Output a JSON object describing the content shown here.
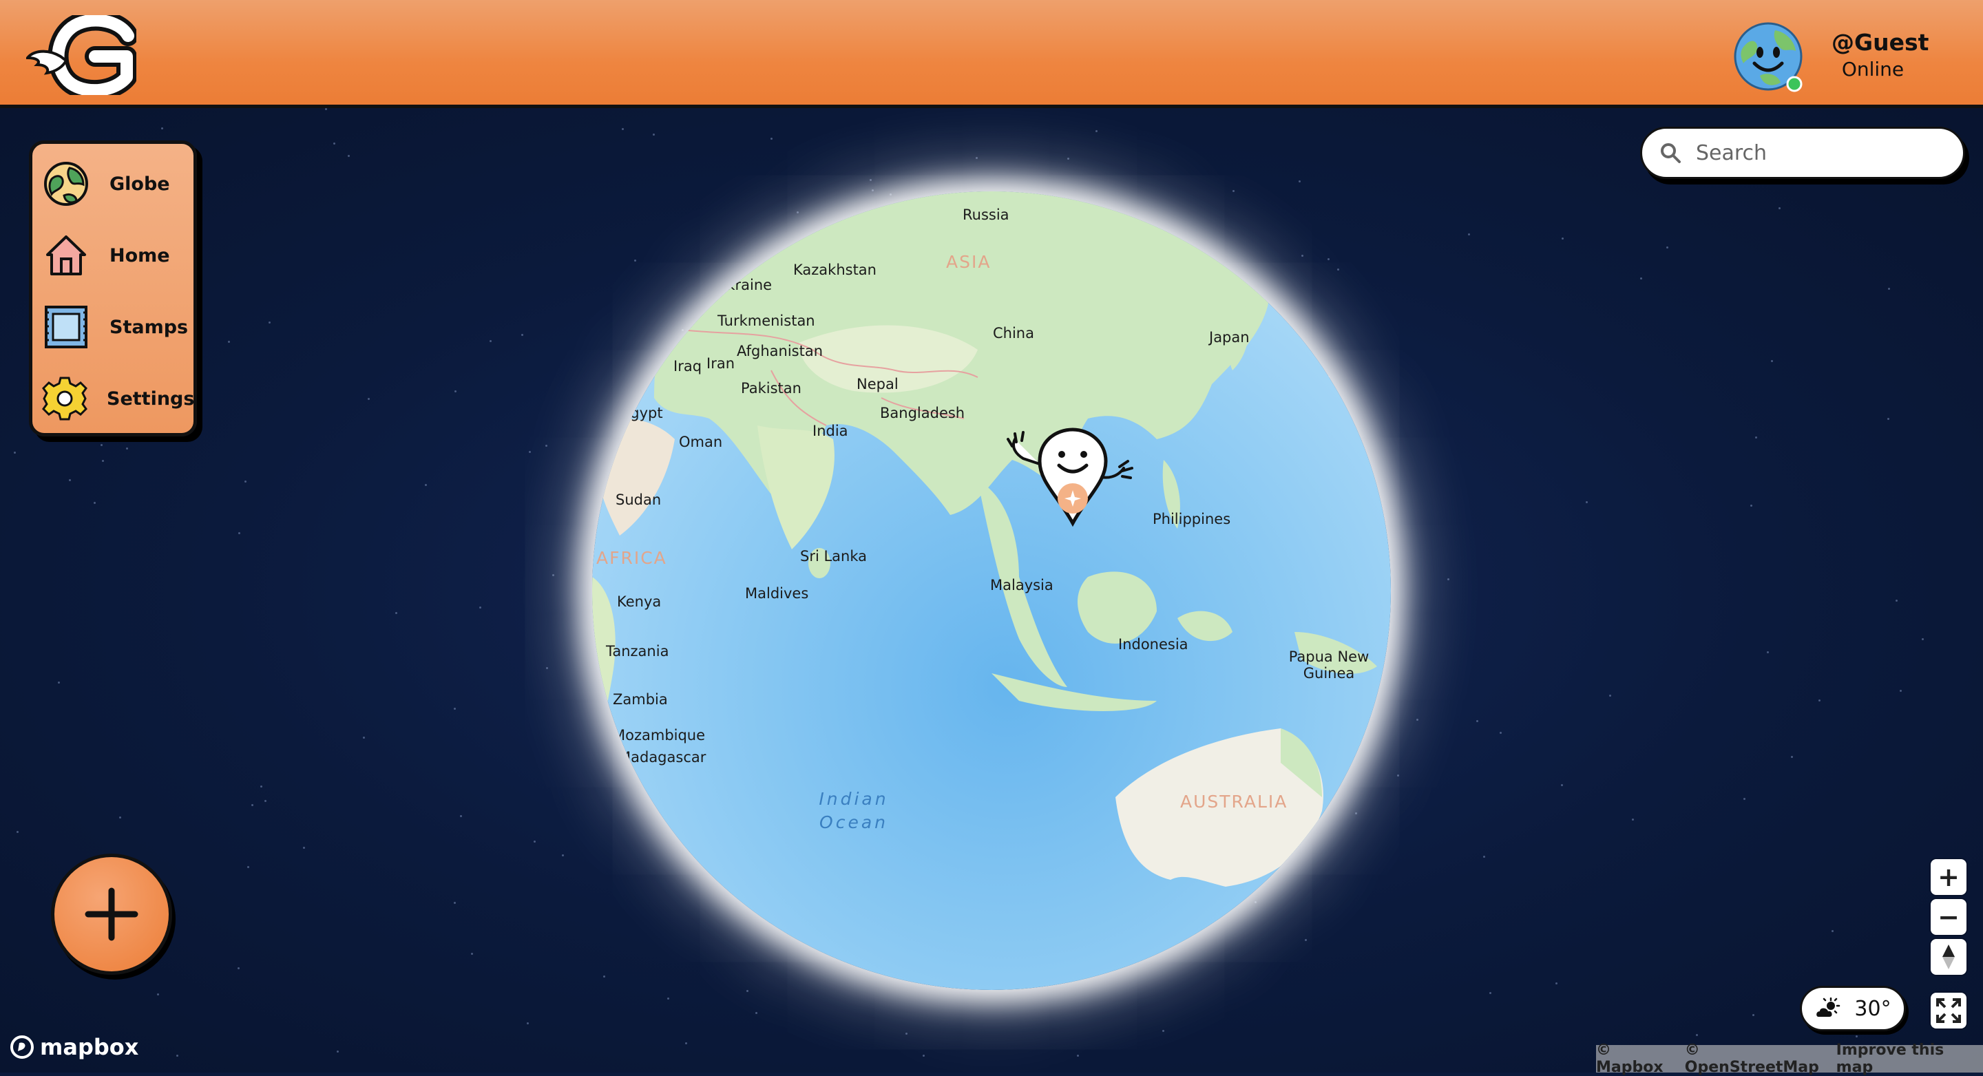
{
  "header": {
    "user": {
      "name": "@Guest",
      "status": "Online"
    }
  },
  "sidebar": {
    "items": [
      {
        "label": "Globe",
        "icon": "globe-icon"
      },
      {
        "label": "Home",
        "icon": "home-icon"
      },
      {
        "label": "Stamps",
        "icon": "stamp-icon"
      },
      {
        "label": "Settings",
        "icon": "gear-icon"
      }
    ]
  },
  "search": {
    "placeholder": "Search"
  },
  "map": {
    "countries": [
      "Russia",
      "Kazakhstan",
      "Ukraine",
      "Turkmenistan",
      "Afghanistan",
      "Iraq",
      "Iran",
      "Pakistan",
      "Nepal",
      "China",
      "Japan",
      "Bangladesh",
      "India",
      "Egypt",
      "Oman",
      "Sudan",
      "Kenya",
      "Tanzania",
      "Zambia",
      "Mozambique",
      "Madagascar",
      "Sri Lanka",
      "Maldives",
      "Malaysia",
      "Philippines",
      "Indonesia",
      "Papua New Guinea"
    ],
    "regions": [
      "ASIA",
      "AFRICA",
      "AUSTRALIA"
    ],
    "ocean": "Indian Ocean"
  },
  "weather": {
    "temperature": "30°",
    "icon": "partly-sunny-icon"
  },
  "controls": {
    "zoom_in": "+",
    "zoom_out": "−"
  },
  "footer": {
    "logo_text": "mapbox",
    "attribution": [
      "© Mapbox",
      "© OpenStreetMap",
      "Improve this map"
    ]
  },
  "colors": {
    "header": "#ee8540",
    "space": "#0b1a3c",
    "accent": "#ec7d36"
  }
}
